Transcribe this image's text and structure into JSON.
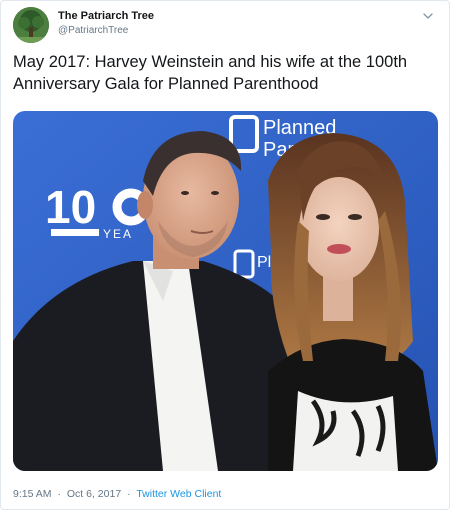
{
  "author": {
    "name": "The Patriarch Tree",
    "handle": "@PatriarchTree",
    "avatar_icon": "tree-avatar"
  },
  "tweet": {
    "text": "May 2017: Harvey Weinstein and his wife at the 100th\nAnniversary Gala for Planned Parenthood"
  },
  "media": {
    "backdrop_logo_line1": "Planned",
    "backdrop_logo_line2": "Parent",
    "backdrop_big_number": "10",
    "backdrop_small_text": "YEA",
    "backdrop_repeat_logo": "Pl",
    "backdrop_color": "#2f5fc4"
  },
  "meta": {
    "time": "9:15 AM",
    "date": "Oct 6, 2017",
    "separator": "·",
    "client": "Twitter Web Client"
  },
  "colors": {
    "link": "#1b95e0",
    "secondary_text": "#657786",
    "primary_text": "#14171a"
  }
}
